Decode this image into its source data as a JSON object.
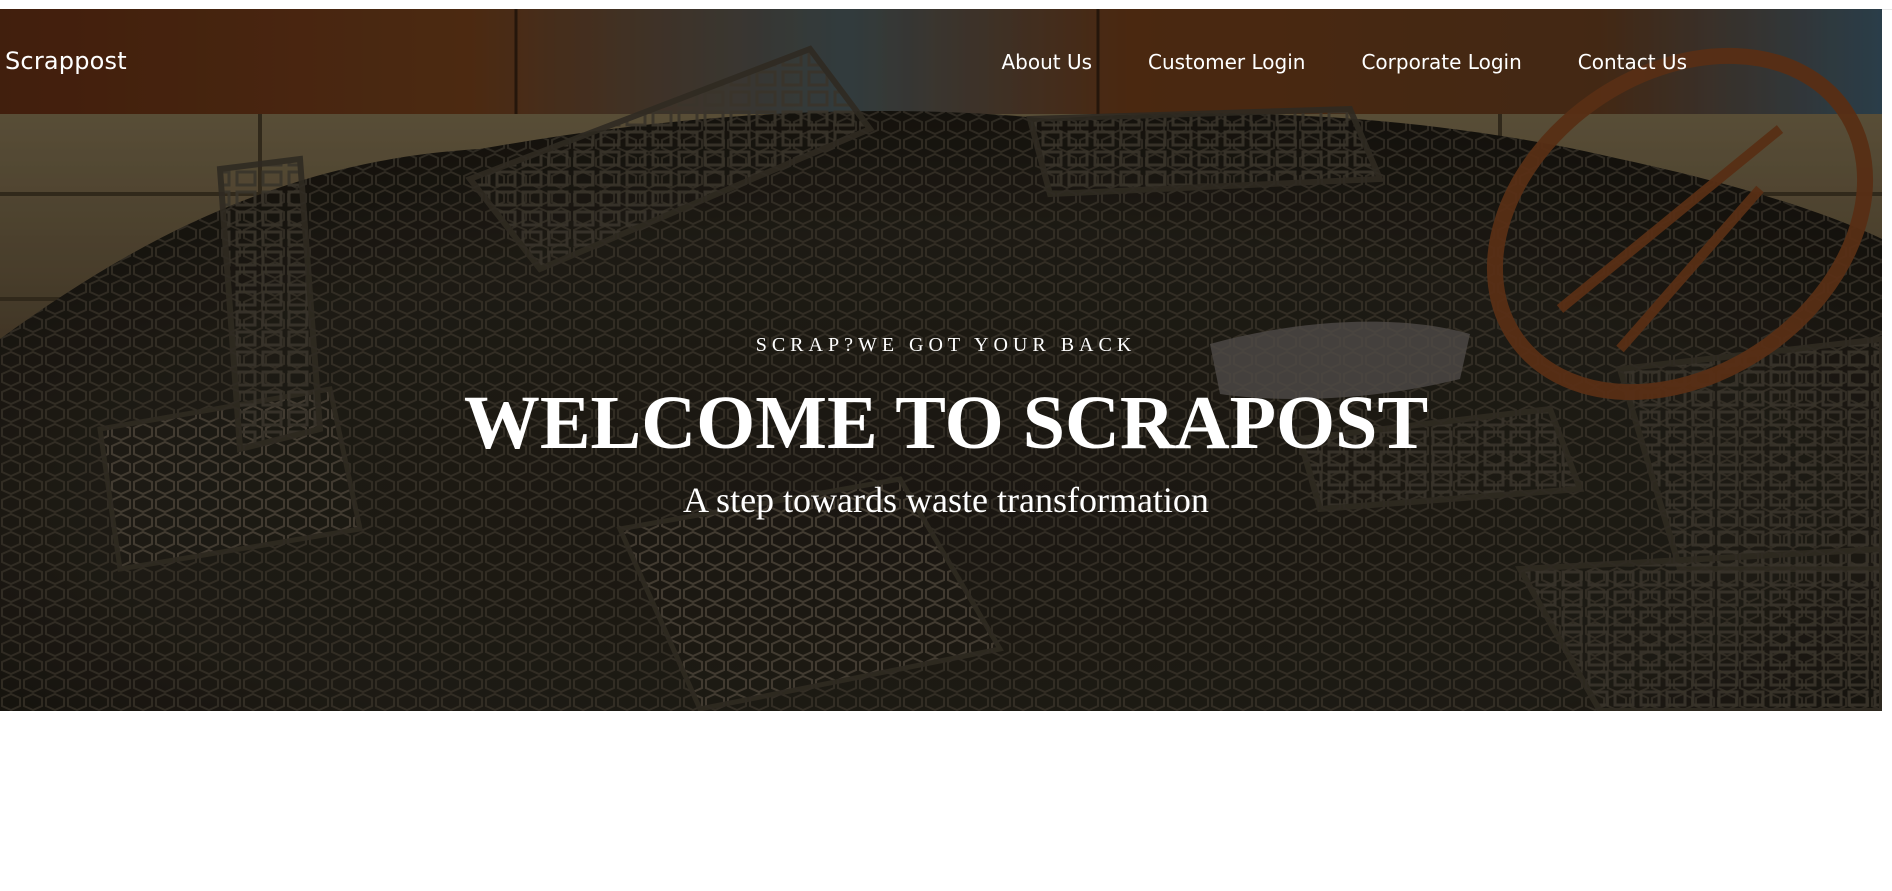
{
  "brand": {
    "name": "Scrappost"
  },
  "nav": {
    "items": [
      {
        "label": "About Us"
      },
      {
        "label": "Customer Login"
      },
      {
        "label": "Corporate Login"
      },
      {
        "label": "Contact Us"
      }
    ]
  },
  "hero": {
    "eyebrow": "SCRAP?WE GOT YOUR BACK",
    "title": "WELCOME TO SCRAPOST",
    "subtitle": "A step towards waste transformation",
    "image": "scrap-metal-pile"
  },
  "colors": {
    "text": "#ffffff",
    "rust": "#8a4a1f",
    "dark": "#1b1712",
    "page": "#ffffff"
  }
}
